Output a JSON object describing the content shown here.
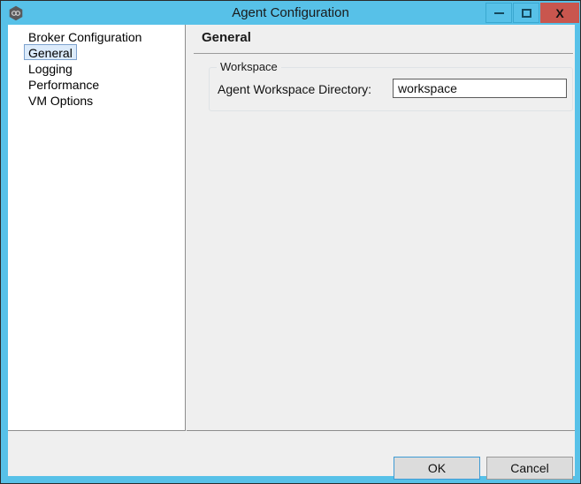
{
  "window": {
    "title": "Agent Configuration",
    "icon": "agent-hexagon-icon",
    "accent_color": "#57c1e8",
    "close_color": "#c9564e",
    "controls": {
      "minimize_label": "–",
      "maximize_label": "□",
      "close_label": "X"
    }
  },
  "sidebar": {
    "items": [
      {
        "label": "Broker Configuration",
        "selected": false
      },
      {
        "label": "General",
        "selected": true
      },
      {
        "label": "Logging",
        "selected": false
      },
      {
        "label": "Performance",
        "selected": false
      },
      {
        "label": "VM Options",
        "selected": false
      }
    ]
  },
  "panel": {
    "title": "General",
    "group": {
      "legend": "Workspace",
      "field": {
        "label": "Agent Workspace Directory:",
        "value": "workspace",
        "placeholder": ""
      }
    }
  },
  "footer": {
    "ok_label": "OK",
    "cancel_label": "Cancel"
  }
}
